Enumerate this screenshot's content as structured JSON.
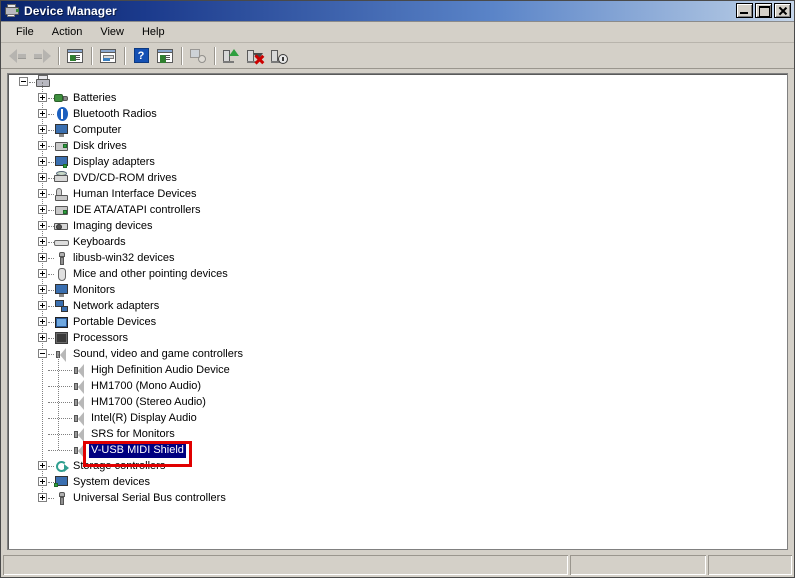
{
  "window": {
    "title": "Device Manager",
    "icon": "device-manager-icon",
    "controls": {
      "minimize": "Minimize",
      "maximize": "Maximize",
      "close": "Close"
    }
  },
  "menu": {
    "items": [
      {
        "label": "File"
      },
      {
        "label": "Action"
      },
      {
        "label": "View"
      },
      {
        "label": "Help"
      }
    ]
  },
  "toolbar": {
    "buttons": [
      {
        "name": "back-button",
        "icon": "back-arrow-icon",
        "label": "Back",
        "enabled": false
      },
      {
        "name": "forward-button",
        "icon": "forward-arrow-icon",
        "label": "Forward",
        "enabled": false
      },
      {
        "name": "show-hide-console-tree-button",
        "icon": "console-tree-icon",
        "label": "Show/Hide Console Tree",
        "enabled": true
      },
      {
        "name": "properties-button",
        "icon": "properties-icon",
        "label": "Properties",
        "enabled": true
      },
      {
        "name": "help-button",
        "icon": "help-question-icon",
        "label": "Help",
        "enabled": true
      },
      {
        "name": "show-tree-pane-button",
        "icon": "tree-pane-icon",
        "label": "Show Pane",
        "enabled": true
      },
      {
        "name": "scan-hardware-button",
        "icon": "scan-magnifier-icon",
        "label": "Scan for hardware changes",
        "enabled": false
      },
      {
        "name": "update-driver-button",
        "icon": "update-driver-icon",
        "label": "Update Driver Software",
        "enabled": true
      },
      {
        "name": "uninstall-device-button",
        "icon": "uninstall-red-x-icon",
        "label": "Uninstall",
        "enabled": true
      },
      {
        "name": "disable-device-button",
        "icon": "disable-device-icon",
        "label": "Disable",
        "enabled": true
      }
    ]
  },
  "tree": {
    "root": {
      "label": "",
      "icon": "computer-root-icon",
      "expanded": true
    },
    "nodes": [
      {
        "label": "Batteries",
        "icon": "battery-icon",
        "expander": "plus",
        "level": 1
      },
      {
        "label": "Bluetooth Radios",
        "icon": "bluetooth-icon",
        "expander": "plus",
        "level": 1
      },
      {
        "label": "Computer",
        "icon": "computer-icon",
        "expander": "plus",
        "level": 1
      },
      {
        "label": "Disk drives",
        "icon": "disk-drive-icon",
        "expander": "plus",
        "level": 1
      },
      {
        "label": "Display adapters",
        "icon": "display-adapter-icon",
        "expander": "plus",
        "level": 1
      },
      {
        "label": "DVD/CD-ROM drives",
        "icon": "dvd-drive-icon",
        "expander": "plus",
        "level": 1
      },
      {
        "label": "Human Interface Devices",
        "icon": "hid-icon",
        "expander": "plus",
        "level": 1
      },
      {
        "label": "IDE ATA/ATAPI controllers",
        "icon": "ide-controller-icon",
        "expander": "plus",
        "level": 1
      },
      {
        "label": "Imaging devices",
        "icon": "imaging-device-icon",
        "expander": "plus",
        "level": 1
      },
      {
        "label": "Keyboards",
        "icon": "keyboard-icon",
        "expander": "plus",
        "level": 1
      },
      {
        "label": "libusb-win32 devices",
        "icon": "usb-device-icon",
        "expander": "plus",
        "level": 1
      },
      {
        "label": "Mice and other pointing devices",
        "icon": "mouse-icon",
        "expander": "plus",
        "level": 1
      },
      {
        "label": "Monitors",
        "icon": "monitor-icon",
        "expander": "plus",
        "level": 1
      },
      {
        "label": "Network adapters",
        "icon": "network-adapter-icon",
        "expander": "plus",
        "level": 1
      },
      {
        "label": "Portable Devices",
        "icon": "portable-device-icon",
        "expander": "plus",
        "level": 1
      },
      {
        "label": "Processors",
        "icon": "processor-icon",
        "expander": "plus",
        "level": 1
      },
      {
        "label": "Sound, video and game controllers",
        "icon": "sound-controller-icon",
        "expander": "minus",
        "level": 1
      },
      {
        "label": "High Definition Audio Device",
        "icon": "speaker-icon",
        "expander": "none",
        "level": 2
      },
      {
        "label": "HM1700 (Mono Audio)",
        "icon": "speaker-icon",
        "expander": "none",
        "level": 2
      },
      {
        "label": "HM1700 (Stereo Audio)",
        "icon": "speaker-icon",
        "expander": "none",
        "level": 2
      },
      {
        "label": "Intel(R) Display Audio",
        "icon": "speaker-icon",
        "expander": "none",
        "level": 2
      },
      {
        "label": "SRS for Monitors",
        "icon": "speaker-icon",
        "expander": "none",
        "level": 2
      },
      {
        "label": "V-USB MIDI Shield",
        "icon": "speaker-icon",
        "expander": "none",
        "level": 2,
        "selected": true
      },
      {
        "label": "Storage controllers",
        "icon": "storage-controller-icon",
        "expander": "plus",
        "level": 1
      },
      {
        "label": "System devices",
        "icon": "system-device-icon",
        "expander": "plus",
        "level": 1
      },
      {
        "label": "Universal Serial Bus controllers",
        "icon": "usb-controller-icon",
        "expander": "plus",
        "level": 1
      }
    ]
  },
  "annotation": {
    "name": "red-highlight-box",
    "target_label": "V-USB MIDI Shield",
    "color": "#e00000"
  },
  "statusbar": {
    "main": "",
    "middle": "",
    "right": ""
  },
  "colors": {
    "titlebar_start": "#0a246a",
    "titlebar_end": "#c6d6ea",
    "selection": "#000080",
    "selection_text": "#ffffff",
    "window_face": "#d4d0c8",
    "annotation_red": "#e00000"
  }
}
